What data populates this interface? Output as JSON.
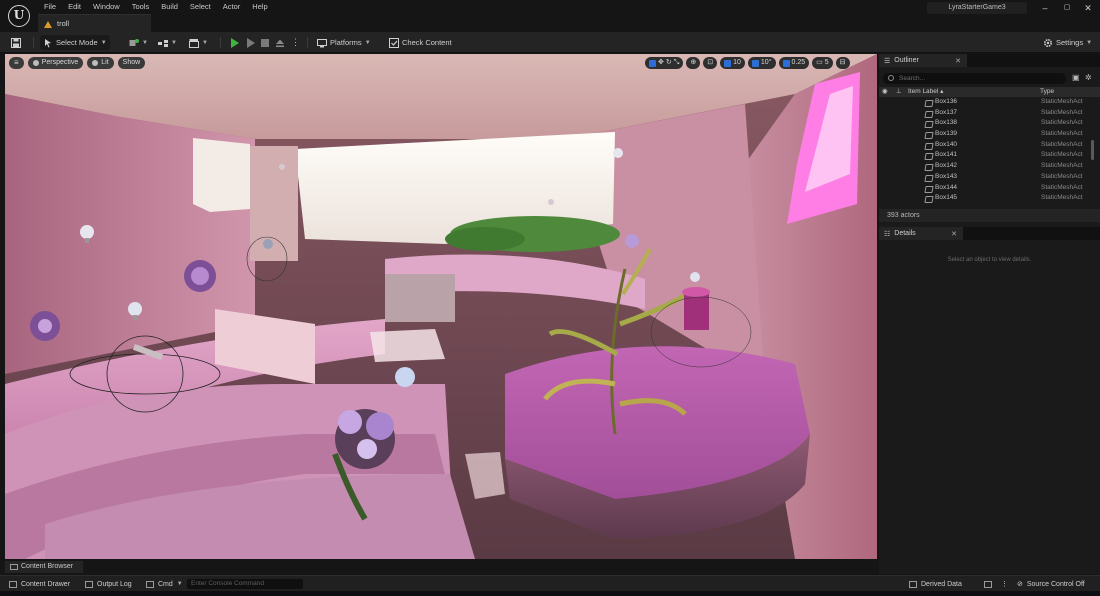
{
  "app": {
    "logo": "U",
    "menu": [
      "File",
      "Edit",
      "Window",
      "Tools",
      "Build",
      "Select",
      "Actor",
      "Help"
    ],
    "document_tab": "troll",
    "project_name": "LyraStarterGame3",
    "window_controls": [
      "–",
      "▢",
      "✕"
    ]
  },
  "toolbar": {
    "save_icon": "save-icon",
    "select_mode": "Select Mode",
    "platforms": "Platforms",
    "check_content": "Check Content",
    "settings": "Settings"
  },
  "viewport": {
    "perspective": "Perspective",
    "lit": "Lit",
    "show": "Show",
    "grid_snap": "10",
    "rotation_snap": "10°",
    "scale_snap": "0.25",
    "camera_speed": "5"
  },
  "outliner": {
    "title": "Outliner",
    "search_placeholder": "Search...",
    "col_label": "Item Label ▴",
    "col_type": "Type",
    "rows": [
      {
        "label": "Box136",
        "type": "StaticMeshAct"
      },
      {
        "label": "Box137",
        "type": "StaticMeshAct"
      },
      {
        "label": "Box138",
        "type": "StaticMeshAct"
      },
      {
        "label": "Box139",
        "type": "StaticMeshAct"
      },
      {
        "label": "Box140",
        "type": "StaticMeshAct"
      },
      {
        "label": "Box141",
        "type": "StaticMeshAct"
      },
      {
        "label": "Box142",
        "type": "StaticMeshAct"
      },
      {
        "label": "Box143",
        "type": "StaticMeshAct"
      },
      {
        "label": "Box144",
        "type": "StaticMeshAct"
      },
      {
        "label": "Box145",
        "type": "StaticMeshAct"
      }
    ],
    "actor_count": "393 actors"
  },
  "details": {
    "title": "Details",
    "empty_text": "Select an object to view details."
  },
  "bottom": {
    "content_browser": "Content Browser",
    "content_drawer": "Content Drawer",
    "output_log": "Output Log",
    "cmd": "Cmd",
    "console_placeholder": "Enter Console Command",
    "derived_data": "Derived Data",
    "source_control": "Source Control Off"
  },
  "colors": {
    "accent_blue": "#2c6ed6",
    "play_green": "#3fb53f",
    "level_icon": "#d89a2a"
  }
}
